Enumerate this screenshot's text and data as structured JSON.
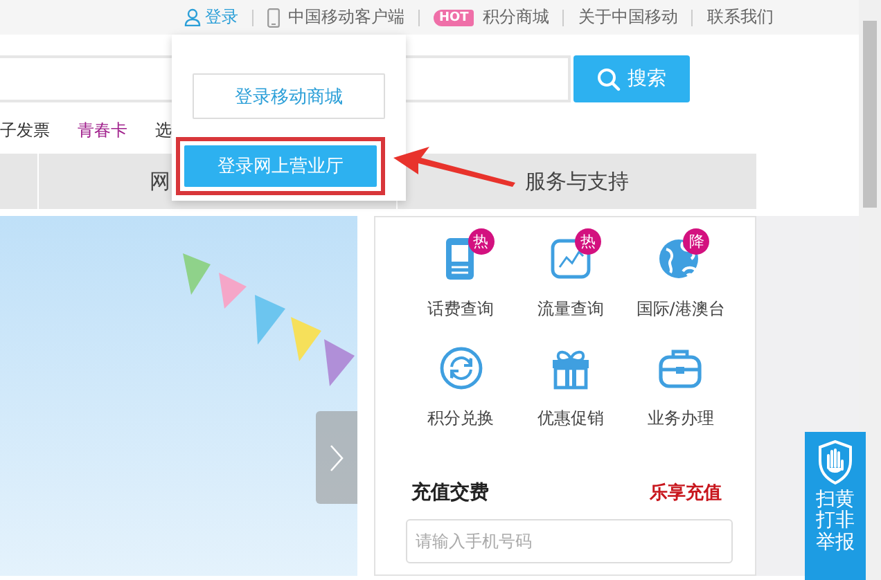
{
  "top_bar": {
    "login": "登录",
    "links": [
      {
        "kind": "app",
        "label": "中国移动客户端"
      },
      {
        "kind": "hot",
        "badge": "HOT",
        "label": "积分商城"
      },
      {
        "kind": "plain",
        "label": "关于中国移动"
      },
      {
        "kind": "plain",
        "label": "联系我们"
      }
    ]
  },
  "search": {
    "button": "搜索"
  },
  "quick_links": [
    {
      "label": "子发票",
      "color": "#333333"
    },
    {
      "label": "青春卡",
      "color": "#a0208c"
    },
    {
      "label": "选",
      "color": "#333333"
    }
  ],
  "nav": [
    {
      "label": "网"
    },
    {
      "label": "服务与支持"
    }
  ],
  "login_menu": {
    "buttons": [
      {
        "kind": "outline",
        "label": "登录移动商城",
        "highlighted": false
      },
      {
        "kind": "primary",
        "label": "登录网上营业厅",
        "highlighted": true
      }
    ]
  },
  "services": [
    {
      "kind": "phone",
      "label": "话费查询",
      "badge": "热"
    },
    {
      "kind": "chart",
      "label": "流量查询",
      "badge": "热"
    },
    {
      "kind": "globe",
      "label": "国际/港澳台",
      "badge": "降"
    },
    {
      "kind": "exchange",
      "label": "积分兑换"
    },
    {
      "kind": "gift",
      "label": "优惠促销"
    },
    {
      "kind": "briefcase",
      "label": "业务办理"
    }
  ],
  "recharge": {
    "title": "充值交费",
    "promo": "乐享充值",
    "phone_field": {
      "placeholder": "请输入手机号码"
    }
  },
  "report_button": {
    "label": "扫黄打非举报"
  }
}
